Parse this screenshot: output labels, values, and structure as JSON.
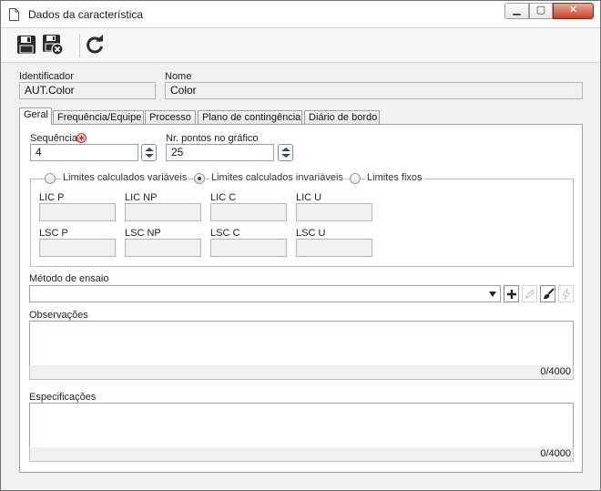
{
  "window": {
    "title": "Dados da característica",
    "minimize": "▁",
    "maximize": "▢",
    "close": "✕"
  },
  "toolbar": {
    "save_icon": "save-icon",
    "save_close_icon": "save-and-close-icon",
    "refresh_icon": "refresh-icon"
  },
  "header": {
    "identifier_label": "Identificador",
    "identifier_value": "AUT.Color",
    "name_label": "Nome",
    "name_value": "Color"
  },
  "tabs": [
    {
      "label": "Geral",
      "active": true
    },
    {
      "label": "Frequência/Equipe"
    },
    {
      "label": "Processo"
    },
    {
      "label": "Plano de contingência"
    },
    {
      "label": "Diário de bordo"
    }
  ],
  "general": {
    "sequence_label": "Sequência",
    "sequence_value": "4",
    "points_label": "Nr. pontos no gráfico",
    "points_value": "25",
    "limits": {
      "options": [
        {
          "label": "Limites calculados variáveis",
          "checked": false
        },
        {
          "label": "Limites calculados invariáveis",
          "checked": true
        },
        {
          "label": "Limites fixos",
          "checked": false
        }
      ],
      "row1": [
        "LIC P",
        "LIC NP",
        "LIC C",
        "LIC U"
      ],
      "row2": [
        "LSC P",
        "LSC NP",
        "LSC C",
        "LSC U"
      ]
    },
    "method_label": "Método de ensaio",
    "method_value": "",
    "observations_label": "Observações",
    "observations_counter": "0/4000",
    "specifications_label": "Especificações",
    "specifications_counter": "0/4000"
  },
  "colors": {
    "required": "#d9261c",
    "close_button": "#c7432b"
  }
}
